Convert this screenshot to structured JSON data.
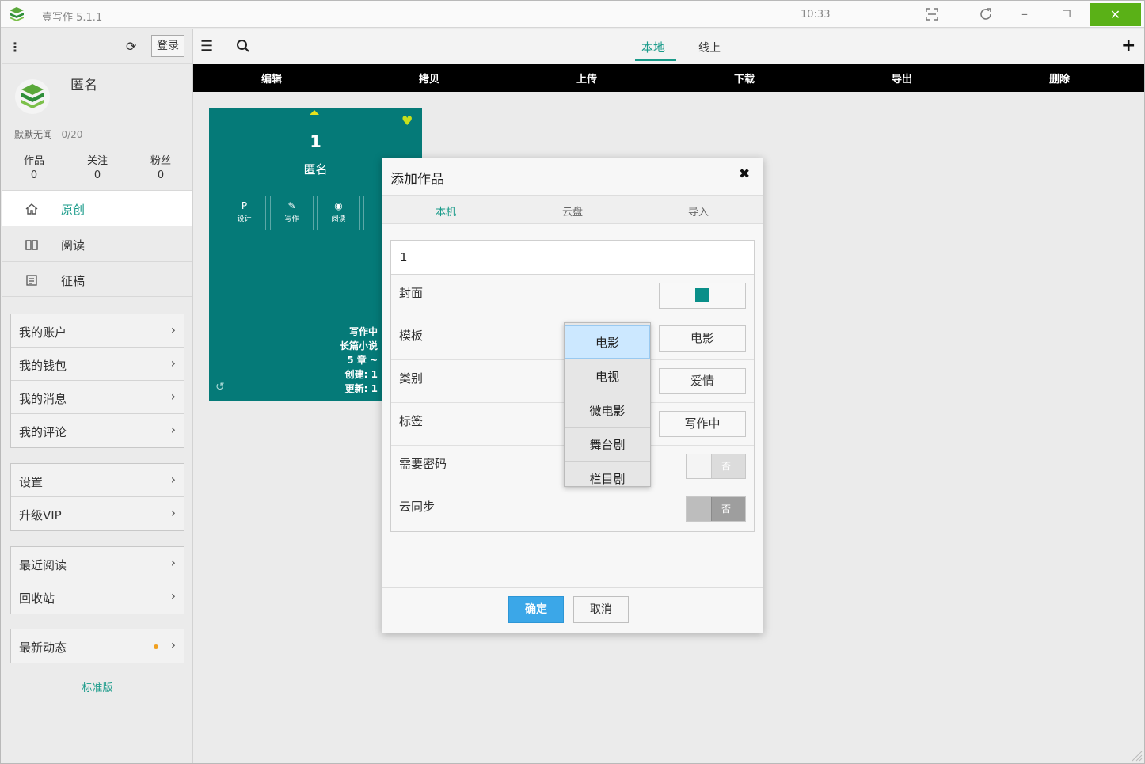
{
  "titlebar": {
    "app_title": "壹写作  5.1.1",
    "clock": "10:33",
    "close": "✕"
  },
  "sidebar": {
    "login": "登录",
    "username": "匿名",
    "motto": "默默无闻",
    "motto_count": "0/20",
    "stats": [
      {
        "label": "作品",
        "value": "0"
      },
      {
        "label": "关注",
        "value": "0"
      },
      {
        "label": "粉丝",
        "value": "0"
      }
    ],
    "nav": [
      {
        "label": "原创",
        "icon": "home-icon"
      },
      {
        "label": "阅读",
        "icon": "book-icon"
      },
      {
        "label": "征稿",
        "icon": "document-icon"
      }
    ],
    "groups": [
      [
        "我的账户",
        "我的钱包",
        "我的消息",
        "我的评论"
      ],
      [
        "设置",
        "升级VIP"
      ],
      [
        "最近阅读",
        "回收站"
      ],
      [
        "最新动态"
      ]
    ],
    "edition": "标准版"
  },
  "main": {
    "tabs": {
      "local": "本地",
      "online": "线上"
    },
    "actions": [
      "编辑",
      "拷贝",
      "上传",
      "下载",
      "导出",
      "删除"
    ]
  },
  "card": {
    "number": "1",
    "author": "匿名",
    "buttons": [
      {
        "label": "设计",
        "icon": "P"
      },
      {
        "label": "写作",
        "icon": "✎"
      },
      {
        "label": "阅读",
        "icon": "◉"
      }
    ],
    "meta": [
      "写作中",
      "长篇小说",
      "5 章 ~",
      "创建: 1",
      "更新: 1"
    ]
  },
  "dialog": {
    "title": "添加作品",
    "close": "✖",
    "tabs": [
      "本机",
      "云盘",
      "导入"
    ],
    "name_value": "1",
    "rows": [
      {
        "label": "封面"
      },
      {
        "label": "模板",
        "value": "电影"
      },
      {
        "label": "类别",
        "value": "爱情"
      },
      {
        "label": "标签",
        "value": "写作中"
      },
      {
        "label": "需要密码",
        "toggle": "否"
      },
      {
        "label": "云同步",
        "toggle": "否"
      }
    ],
    "ok": "确定",
    "cancel": "取消"
  },
  "dropdown": {
    "options": [
      "电影",
      "电视",
      "微电影",
      "舞台剧",
      "栏目剧"
    ],
    "selected": "电影"
  },
  "colors": {
    "accent": "#1a9b8a",
    "card": "#057a78",
    "close_button": "#5ab117",
    "ok_button": "#3ba7e8"
  }
}
